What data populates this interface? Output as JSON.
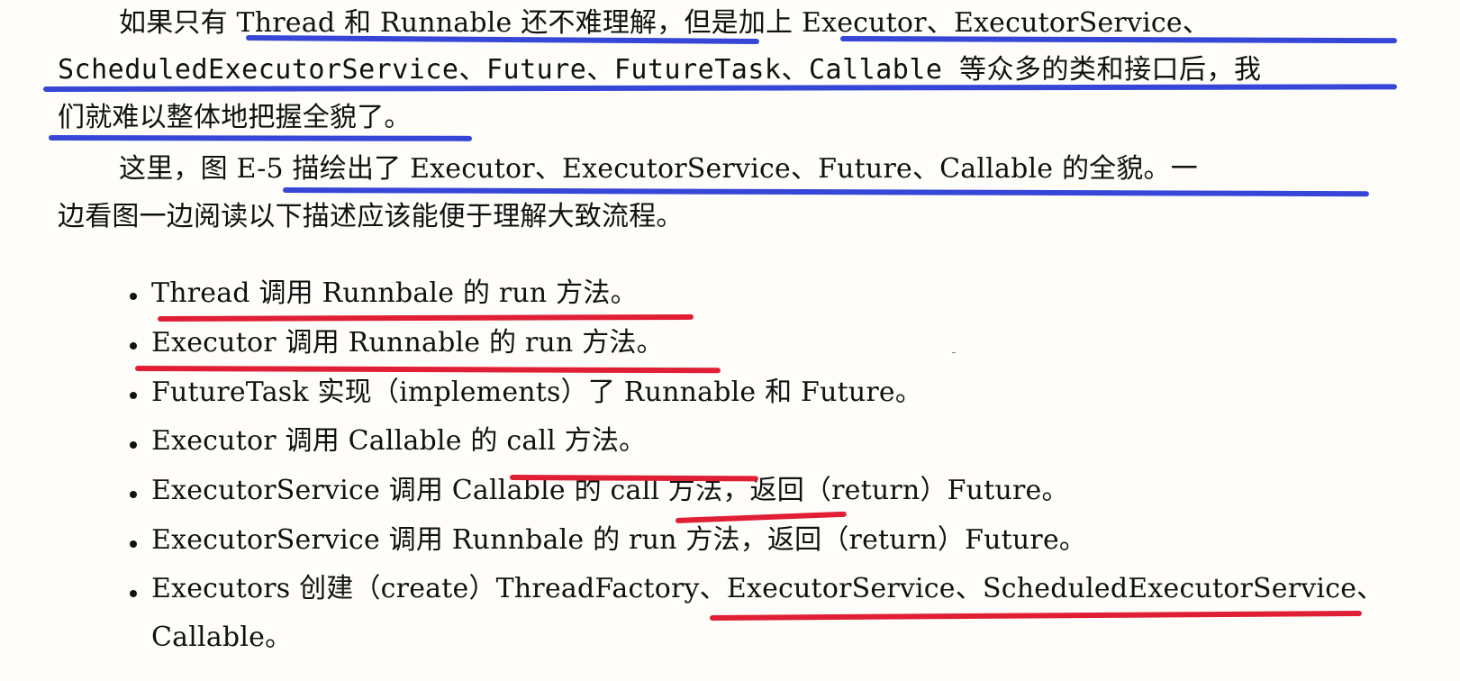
{
  "colors": {
    "background": "#fffdfa",
    "text": "#111111",
    "blue_underline": "#3647d8",
    "red_underline": "#e01e34"
  },
  "paragraphs": [
    {
      "line1": "如果只有 Thread 和 Runnable 还不难理解，但是加上 Executor、ExecutorService、",
      "line2": "ScheduledExecutorService、Future、FutureTask、Callable 等众多的类和接口后，我",
      "line3": "们就难以整体地把握全貌了。"
    },
    {
      "line1": "这里，图 E-5 描绘出了 Executor、ExecutorService、Future、Callable 的全貌。一",
      "line2": "边看图一边阅读以下描述应该能便于理解大致流程。"
    }
  ],
  "bullets": [
    "Thread 调用 Runnbale 的 run 方法。",
    "Executor 调用 Runnable 的 run 方法。",
    "FutureTask 实现（implements）了 Runnable 和 Future。",
    "Executor 调用 Callable 的 call 方法。",
    "ExecutorService 调用 Callable 的 call 方法，返回（return）Future。",
    "ExecutorService 调用 Runnbale 的 run 方法，返回（return）Future。",
    "Executors 创建（create）ThreadFactory、ExecutorService、ScheduledExecutorService、",
    "Callable。"
  ]
}
